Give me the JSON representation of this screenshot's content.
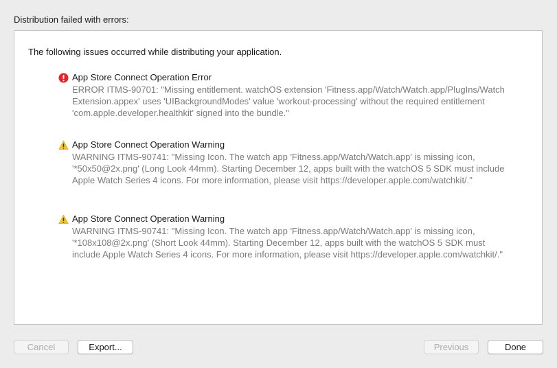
{
  "dialog": {
    "heading": "Distribution failed with errors:",
    "intro": "The following issues occurred while distributing your application."
  },
  "issues": [
    {
      "severity": "error",
      "icon": "error-icon",
      "title": "App Store Connect Operation Error",
      "lines": [
        "ERROR ITMS-90701: \"Missing entitlement. watchOS extension 'Fitness.app/Watch/Watch.app/PlugIns/Watch",
        "Extension.appex' uses 'UIBackgroundModes' value 'workout-processing' without the required entitlement",
        "'com.apple.developer.healthkit' signed into the bundle.\""
      ]
    },
    {
      "severity": "warning",
      "icon": "warning-icon",
      "title": "App Store Connect Operation Warning",
      "lines": [
        "WARNING ITMS-90741: \"Missing Icon. The watch app 'Fitness.app/Watch/Watch.app' is missing icon,",
        "'*50x50@2x.png' (Long Look 44mm). Starting December 12, apps built with the watchOS 5 SDK must include",
        "Apple Watch Series 4 icons. For more information, please visit https://developer.apple.com/watchkit/.\""
      ]
    },
    {
      "severity": "warning",
      "icon": "warning-icon",
      "title": "App Store Connect Operation Warning",
      "lines": [
        "WARNING ITMS-90741: \"Missing Icon. The watch app 'Fitness.app/Watch/Watch.app' is missing icon,",
        "'*108x108@2x.png' (Short Look 44mm). Starting December 12, apps built with the watchOS 5 SDK must",
        "include Apple Watch Series 4 icons. For more information, please visit https://developer.apple.com/watchkit/.\""
      ]
    }
  ],
  "buttons": {
    "cancel": "Cancel",
    "export": "Export...",
    "previous": "Previous",
    "done": "Done"
  },
  "colors": {
    "error": "#e0262b",
    "warning": "#f5c523",
    "panel_border": "#c2c2c2",
    "background": "#ececec"
  }
}
